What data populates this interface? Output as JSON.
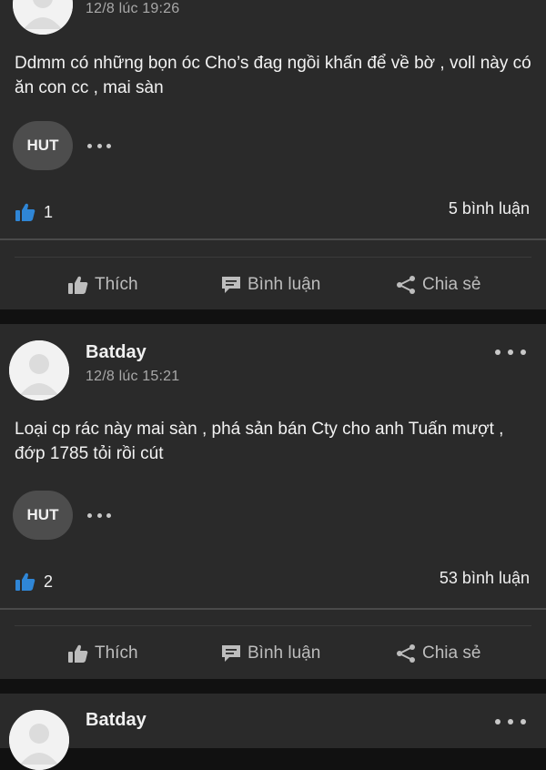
{
  "posts": [
    {
      "author": "",
      "time": "12/8 lúc 19:26",
      "content": "Ddmm có những bọn óc Cho’s đag ngồi khấn để về bờ , voll này có ăn con cc , mai sàn",
      "badge": "HUT",
      "like_count": "1",
      "comments": "5 bình luận"
    },
    {
      "author": "Batday",
      "time": "12/8 lúc 15:21",
      "content": "Loại cp rác này mai sàn , phá sản bán Cty cho anh Tuấn mượt , đớp 1785 tỏi rồi cút",
      "badge": "HUT",
      "like_count": "2",
      "comments": "53 bình luận"
    },
    {
      "author": "Batday"
    }
  ],
  "actions": {
    "like": "Thích",
    "comment": "Bình luận",
    "share": "Chia sẻ"
  },
  "icons": {
    "like_count": "thumbs-up-icon",
    "like": "thumbs-up-icon",
    "comment": "comment-bubble-icon",
    "share": "share-icon",
    "more": "more-dots-icon"
  },
  "colors": {
    "card": "#2a2a2a",
    "background": "#111111",
    "like_blue": "#2f86d6",
    "badge": "#4d4d4d"
  }
}
